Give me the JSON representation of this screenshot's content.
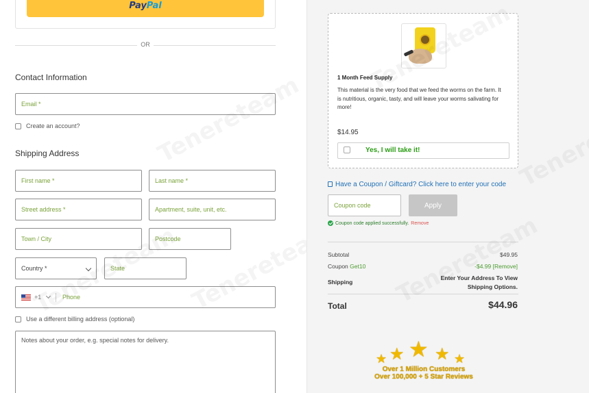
{
  "payment": {
    "paypal_part1": "Pay",
    "paypal_part2": "Pal",
    "or_label": "OR"
  },
  "contact": {
    "title": "Contact Information",
    "email_placeholder": "Email *",
    "create_account_label": "Create an account?"
  },
  "shipping": {
    "title": "Shipping Address",
    "first_name_placeholder": "First name *",
    "last_name_placeholder": "Last name *",
    "street_placeholder": "Street address *",
    "apartment_placeholder": "Apartment, suite, unit, etc.",
    "city_placeholder": "Town / City",
    "postcode_placeholder": "Postcode",
    "country_value": "Country *",
    "state_placeholder": "State",
    "phone_dial_code": "+1",
    "phone_placeholder": "Phone",
    "different_billing_label": "Use a different billing address (optional)",
    "notes_placeholder": "Notes about your order, e.g. special notes for delivery."
  },
  "offer": {
    "product_title": "1 Month Feed Supply",
    "description": "This material is the very food that we feed the worms on the farm. It is nutritious, organic, tasty, and will leave your worms salivating for more!",
    "price": "$14.95",
    "take_label": "Yes, I will take it!"
  },
  "coupon": {
    "link_text": "Have a Coupon / Giftcard? Click here to enter your code",
    "input_placeholder": "Coupon code",
    "apply_label": "Apply",
    "success_message": "Coupon code applied successfully.",
    "remove_label": "Remove"
  },
  "summary": {
    "subtotal_label": "Subtotal",
    "subtotal_value": "$49.95",
    "coupon_label": "Coupon",
    "coupon_code": "Get10",
    "coupon_value": "-$4.99 [Remove]",
    "shipping_label": "Shipping",
    "shipping_value_line1": "Enter Your Address To View",
    "shipping_value_line2": "Shipping Options.",
    "total_label": "Total",
    "total_value": "$44.96"
  },
  "badge": {
    "line1": "Over 1 Million Customers",
    "line2": "Over 100,000 + 5 Star Reviews"
  },
  "watermark_text": "Tenereteam",
  "colors": {
    "paypal_yellow": "#ffc439",
    "placeholder_green": "#7aa23a",
    "link_blue": "#1f6fb5",
    "take_green": "#2a9d14",
    "star_gold": "#f0b900"
  }
}
